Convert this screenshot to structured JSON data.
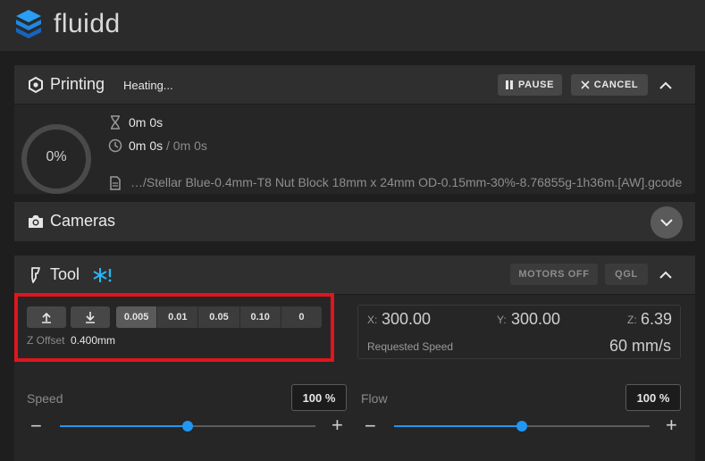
{
  "app": {
    "brand": "fluidd"
  },
  "printing": {
    "title": "Printing",
    "status": "Heating...",
    "pause_label": "PAUSE",
    "cancel_label": "CANCEL",
    "progress": {
      "percent": 0,
      "label": "0%"
    },
    "elapsed": "0m 0s",
    "remaining": "0m 0s",
    "remaining_total": "/ 0m 0s",
    "filename": "…/Stellar Blue-0.4mm-T8 Nut Block 18mm x 24mm OD-0.15mm-30%-8.76855g-1h36m.[AW].gcode"
  },
  "cameras": {
    "title": "Cameras"
  },
  "tool": {
    "title": "Tool",
    "motors_off_label": "MOTORS OFF",
    "qgl_label": "QGL",
    "z_steps": [
      "0.005",
      "0.01",
      "0.05",
      "0.10",
      "0"
    ],
    "active_step": "0.005",
    "z_offset_label": "Z Offset",
    "z_offset_value": "0.400mm",
    "position": {
      "x_label": "X:",
      "x_value": "300.00",
      "y_label": "Y:",
      "y_value": "300.00",
      "z_label": "Z:",
      "z_value": "6.39",
      "speed_label": "Requested Speed",
      "speed_value": "60 mm/s"
    },
    "speed": {
      "label": "Speed",
      "value": "100 %",
      "fraction": 0.5
    },
    "flow": {
      "label": "Flow",
      "value": "100 %",
      "fraction": 0.5
    }
  },
  "colors": {
    "accent": "#2196f3",
    "highlight": "#e0151d",
    "logo": "#1e88e5"
  }
}
